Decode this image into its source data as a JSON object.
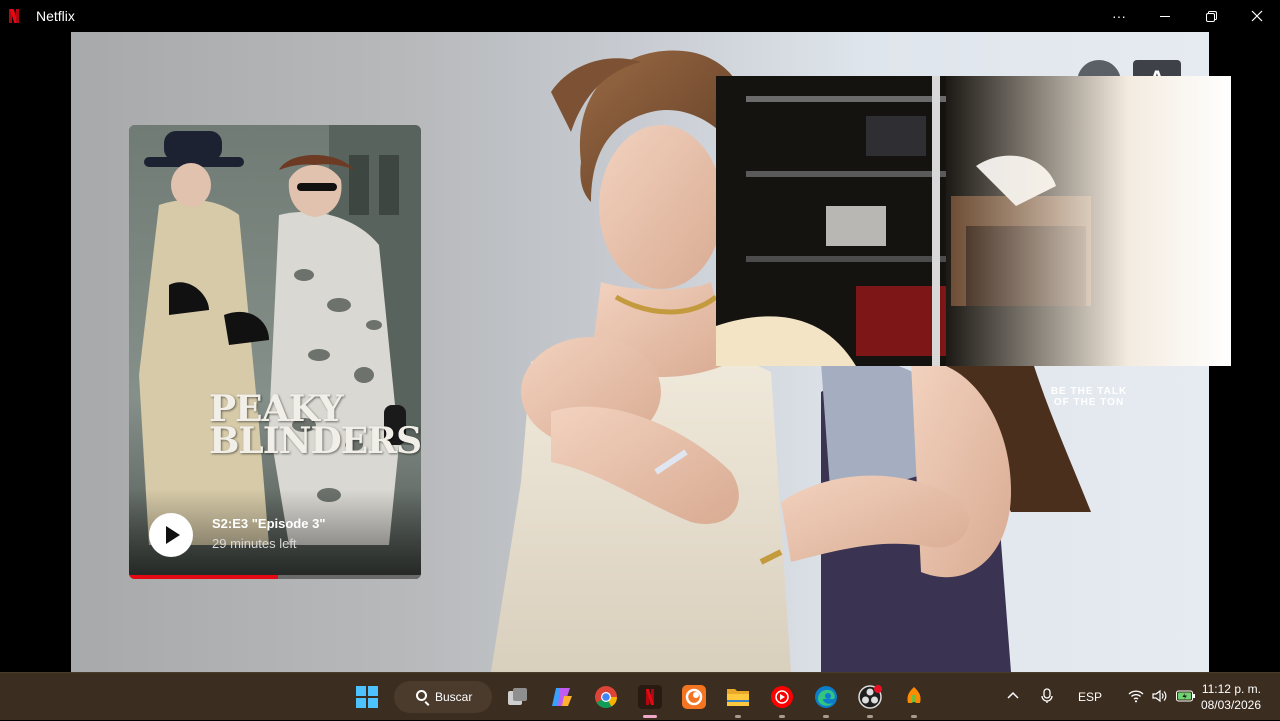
{
  "window": {
    "title": "Netflix",
    "controls": {
      "more": "···",
      "minimize": "—",
      "restore": "❐",
      "close": "✕"
    }
  },
  "header": {
    "profile_initial": "A"
  },
  "continue_watching": {
    "show_title_line1": "PEAKY",
    "show_title_line2": "BLINDERS",
    "episode": "S2:E3 \"Episode 3\"",
    "time_left": "29 minutes left",
    "progress": 0.51
  },
  "hero": {
    "tagline_line1": "BE THE TALK",
    "tagline_line2": "OF THE TON"
  },
  "taskbar": {
    "search_label": "Buscar",
    "apps": [
      "windows-start-icon",
      "task-view-icon",
      "copilot-icon",
      "chrome-icon",
      "netflix-icon",
      "crunchyroll-icon",
      "file-explorer-icon",
      "youtube-music-icon",
      "edge-icon",
      "obs-icon",
      "fl-studio-icon"
    ],
    "tray": {
      "language": "ESP",
      "time": "11:12 p. m.",
      "date": "08/03/2026"
    }
  },
  "colors": {
    "netflix_red": "#e50914",
    "taskbar_bg": "#3b2d1f"
  }
}
